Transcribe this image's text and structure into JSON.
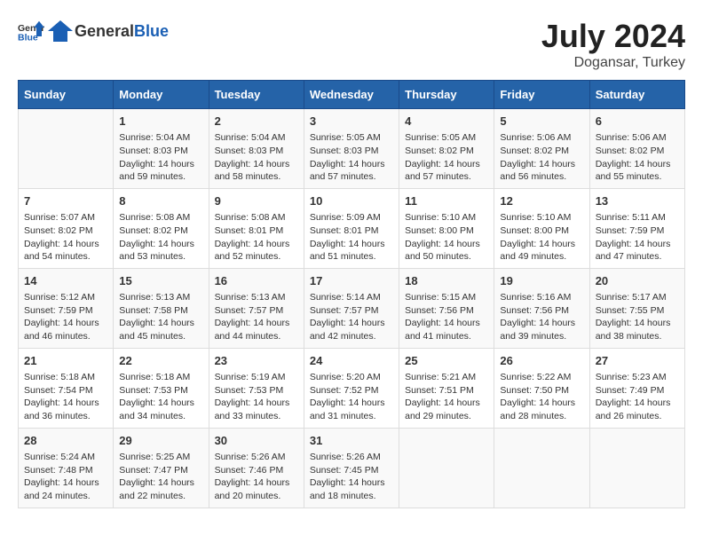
{
  "logo": {
    "text_general": "General",
    "text_blue": "Blue"
  },
  "title": "July 2024",
  "subtitle": "Dogansar, Turkey",
  "days_of_week": [
    "Sunday",
    "Monday",
    "Tuesday",
    "Wednesday",
    "Thursday",
    "Friday",
    "Saturday"
  ],
  "weeks": [
    [
      {
        "day": "",
        "content": ""
      },
      {
        "day": "1",
        "content": "Sunrise: 5:04 AM\nSunset: 8:03 PM\nDaylight: 14 hours\nand 59 minutes."
      },
      {
        "day": "2",
        "content": "Sunrise: 5:04 AM\nSunset: 8:03 PM\nDaylight: 14 hours\nand 58 minutes."
      },
      {
        "day": "3",
        "content": "Sunrise: 5:05 AM\nSunset: 8:03 PM\nDaylight: 14 hours\nand 57 minutes."
      },
      {
        "day": "4",
        "content": "Sunrise: 5:05 AM\nSunset: 8:02 PM\nDaylight: 14 hours\nand 57 minutes."
      },
      {
        "day": "5",
        "content": "Sunrise: 5:06 AM\nSunset: 8:02 PM\nDaylight: 14 hours\nand 56 minutes."
      },
      {
        "day": "6",
        "content": "Sunrise: 5:06 AM\nSunset: 8:02 PM\nDaylight: 14 hours\nand 55 minutes."
      }
    ],
    [
      {
        "day": "7",
        "content": "Sunrise: 5:07 AM\nSunset: 8:02 PM\nDaylight: 14 hours\nand 54 minutes."
      },
      {
        "day": "8",
        "content": "Sunrise: 5:08 AM\nSunset: 8:02 PM\nDaylight: 14 hours\nand 53 minutes."
      },
      {
        "day": "9",
        "content": "Sunrise: 5:08 AM\nSunset: 8:01 PM\nDaylight: 14 hours\nand 52 minutes."
      },
      {
        "day": "10",
        "content": "Sunrise: 5:09 AM\nSunset: 8:01 PM\nDaylight: 14 hours\nand 51 minutes."
      },
      {
        "day": "11",
        "content": "Sunrise: 5:10 AM\nSunset: 8:00 PM\nDaylight: 14 hours\nand 50 minutes."
      },
      {
        "day": "12",
        "content": "Sunrise: 5:10 AM\nSunset: 8:00 PM\nDaylight: 14 hours\nand 49 minutes."
      },
      {
        "day": "13",
        "content": "Sunrise: 5:11 AM\nSunset: 7:59 PM\nDaylight: 14 hours\nand 47 minutes."
      }
    ],
    [
      {
        "day": "14",
        "content": "Sunrise: 5:12 AM\nSunset: 7:59 PM\nDaylight: 14 hours\nand 46 minutes."
      },
      {
        "day": "15",
        "content": "Sunrise: 5:13 AM\nSunset: 7:58 PM\nDaylight: 14 hours\nand 45 minutes."
      },
      {
        "day": "16",
        "content": "Sunrise: 5:13 AM\nSunset: 7:57 PM\nDaylight: 14 hours\nand 44 minutes."
      },
      {
        "day": "17",
        "content": "Sunrise: 5:14 AM\nSunset: 7:57 PM\nDaylight: 14 hours\nand 42 minutes."
      },
      {
        "day": "18",
        "content": "Sunrise: 5:15 AM\nSunset: 7:56 PM\nDaylight: 14 hours\nand 41 minutes."
      },
      {
        "day": "19",
        "content": "Sunrise: 5:16 AM\nSunset: 7:56 PM\nDaylight: 14 hours\nand 39 minutes."
      },
      {
        "day": "20",
        "content": "Sunrise: 5:17 AM\nSunset: 7:55 PM\nDaylight: 14 hours\nand 38 minutes."
      }
    ],
    [
      {
        "day": "21",
        "content": "Sunrise: 5:18 AM\nSunset: 7:54 PM\nDaylight: 14 hours\nand 36 minutes."
      },
      {
        "day": "22",
        "content": "Sunrise: 5:18 AM\nSunset: 7:53 PM\nDaylight: 14 hours\nand 34 minutes."
      },
      {
        "day": "23",
        "content": "Sunrise: 5:19 AM\nSunset: 7:53 PM\nDaylight: 14 hours\nand 33 minutes."
      },
      {
        "day": "24",
        "content": "Sunrise: 5:20 AM\nSunset: 7:52 PM\nDaylight: 14 hours\nand 31 minutes."
      },
      {
        "day": "25",
        "content": "Sunrise: 5:21 AM\nSunset: 7:51 PM\nDaylight: 14 hours\nand 29 minutes."
      },
      {
        "day": "26",
        "content": "Sunrise: 5:22 AM\nSunset: 7:50 PM\nDaylight: 14 hours\nand 28 minutes."
      },
      {
        "day": "27",
        "content": "Sunrise: 5:23 AM\nSunset: 7:49 PM\nDaylight: 14 hours\nand 26 minutes."
      }
    ],
    [
      {
        "day": "28",
        "content": "Sunrise: 5:24 AM\nSunset: 7:48 PM\nDaylight: 14 hours\nand 24 minutes."
      },
      {
        "day": "29",
        "content": "Sunrise: 5:25 AM\nSunset: 7:47 PM\nDaylight: 14 hours\nand 22 minutes."
      },
      {
        "day": "30",
        "content": "Sunrise: 5:26 AM\nSunset: 7:46 PM\nDaylight: 14 hours\nand 20 minutes."
      },
      {
        "day": "31",
        "content": "Sunrise: 5:26 AM\nSunset: 7:45 PM\nDaylight: 14 hours\nand 18 minutes."
      },
      {
        "day": "",
        "content": ""
      },
      {
        "day": "",
        "content": ""
      },
      {
        "day": "",
        "content": ""
      }
    ]
  ],
  "colors": {
    "header_bg": "#2563a8",
    "header_text": "#ffffff",
    "accent": "#1a5fb4"
  }
}
